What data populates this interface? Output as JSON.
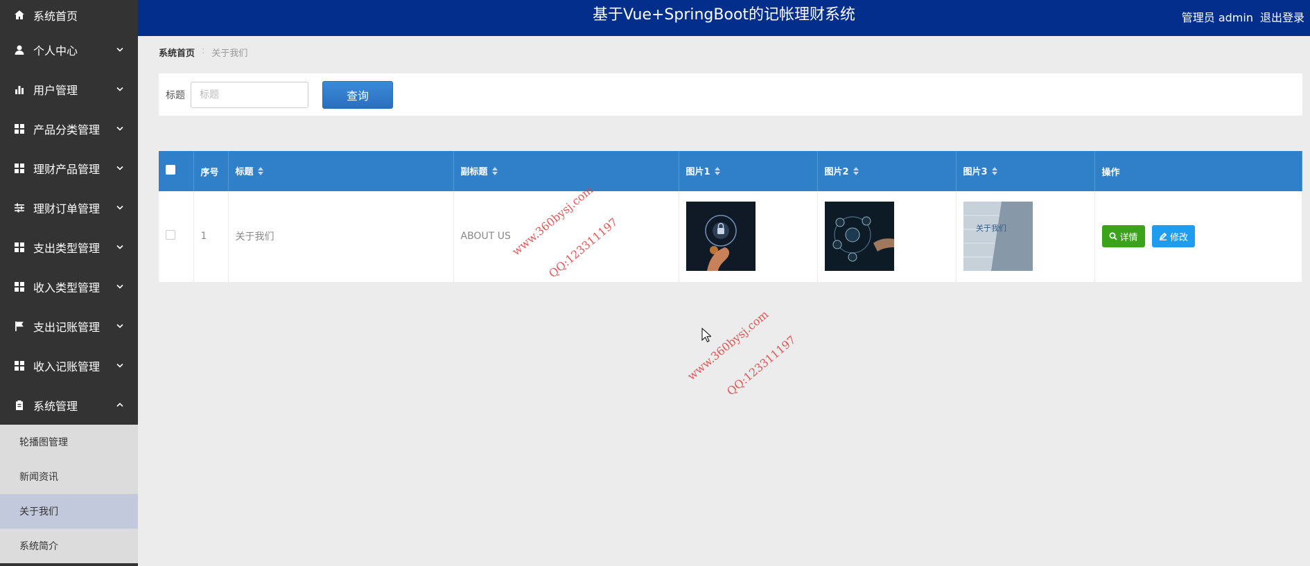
{
  "header": {
    "title": "基于Vue+SpringBoot的记帐理财系统",
    "user_role": "管理员",
    "username": "admin",
    "logout": "退出登录"
  },
  "sidebar": {
    "items": [
      {
        "label": "系统首页",
        "icon": "home-icon"
      },
      {
        "label": "个人中心",
        "icon": "person-icon"
      },
      {
        "label": "用户管理",
        "icon": "bar-chart-icon"
      },
      {
        "label": "产品分类管理",
        "icon": "grid-icon"
      },
      {
        "label": "理财产品管理",
        "icon": "grid-icon"
      },
      {
        "label": "理财订单管理",
        "icon": "sliders-icon"
      },
      {
        "label": "支出类型管理",
        "icon": "grid-icon"
      },
      {
        "label": "收入类型管理",
        "icon": "grid-icon"
      },
      {
        "label": "支出记账管理",
        "icon": "flag-icon"
      },
      {
        "label": "收入记账管理",
        "icon": "grid-icon"
      },
      {
        "label": "系统管理",
        "icon": "clipboard-icon"
      }
    ],
    "submenu": [
      "轮播图管理",
      "新闻资讯",
      "关于我们",
      "系统简介"
    ]
  },
  "breadcrumb": {
    "home": "系统首页",
    "separator": ":",
    "current": "关于我们"
  },
  "search": {
    "label": "标题",
    "placeholder": "标题",
    "button": "查询"
  },
  "table": {
    "columns": [
      "序号",
      "标题",
      "副标题",
      "图片1",
      "图片2",
      "图片3",
      "操作"
    ],
    "rows": [
      {
        "index": "1",
        "title": "关于我们",
        "subtitle": "ABOUT US",
        "image3_text": "关于我们"
      }
    ],
    "detail_button": "详情",
    "edit_button": "修改"
  },
  "watermarks": {
    "site": "www.360bysj.com",
    "qq": "QQ:123311197"
  },
  "colors": {
    "header_bg": "#032e8b",
    "sidebar_bg": "#333333",
    "table_header_bg": "#2f80c8",
    "detail_btn": "#3aa31a",
    "edit_btn": "#1e9df0"
  }
}
